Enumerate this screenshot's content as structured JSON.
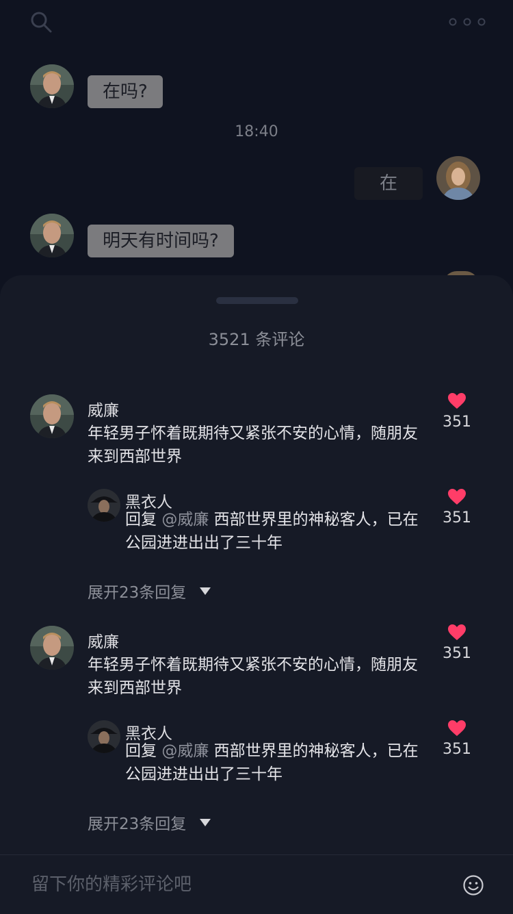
{
  "chat": {
    "messages": [
      {
        "side": "left",
        "text": "在吗?"
      },
      {
        "side": "right",
        "text": "在"
      },
      {
        "side": "left",
        "text": "明天有时间吗?"
      }
    ],
    "timestamp": "18:40"
  },
  "comments": {
    "title": "3521 条评论",
    "threads": [
      {
        "author": "威廉",
        "text": "年轻男子怀着既期待又紧张不安的心情，随朋友来到西部世界",
        "likes": "351",
        "reply": {
          "author": "黑衣人",
          "prefix": "回复",
          "mention": "@威廉",
          "text": "西部世界里的神秘客人，已在公园进进出出了三十年",
          "likes": "351"
        },
        "expand_label": "展开23条回复"
      },
      {
        "author": "威廉",
        "text": "年轻男子怀着既期待又紧张不安的心情，随朋友来到西部世界",
        "likes": "351",
        "reply": {
          "author": "黑衣人",
          "prefix": "回复",
          "mention": "@威廉",
          "text": "西部世界里的神秘客人，已在公园进进出出了三十年",
          "likes": "351"
        },
        "expand_label": "展开23条回复"
      }
    ]
  },
  "input": {
    "placeholder": "留下你的精彩评论吧"
  },
  "colors": {
    "background": "#0f1320",
    "sheet": "#161a26",
    "like_heart": "#ff3d68",
    "bubble_left": "#7b7b7e"
  },
  "icons": [
    "search-icon",
    "more-icon",
    "heart-icon",
    "chevron-down-icon",
    "emoji-icon"
  ]
}
